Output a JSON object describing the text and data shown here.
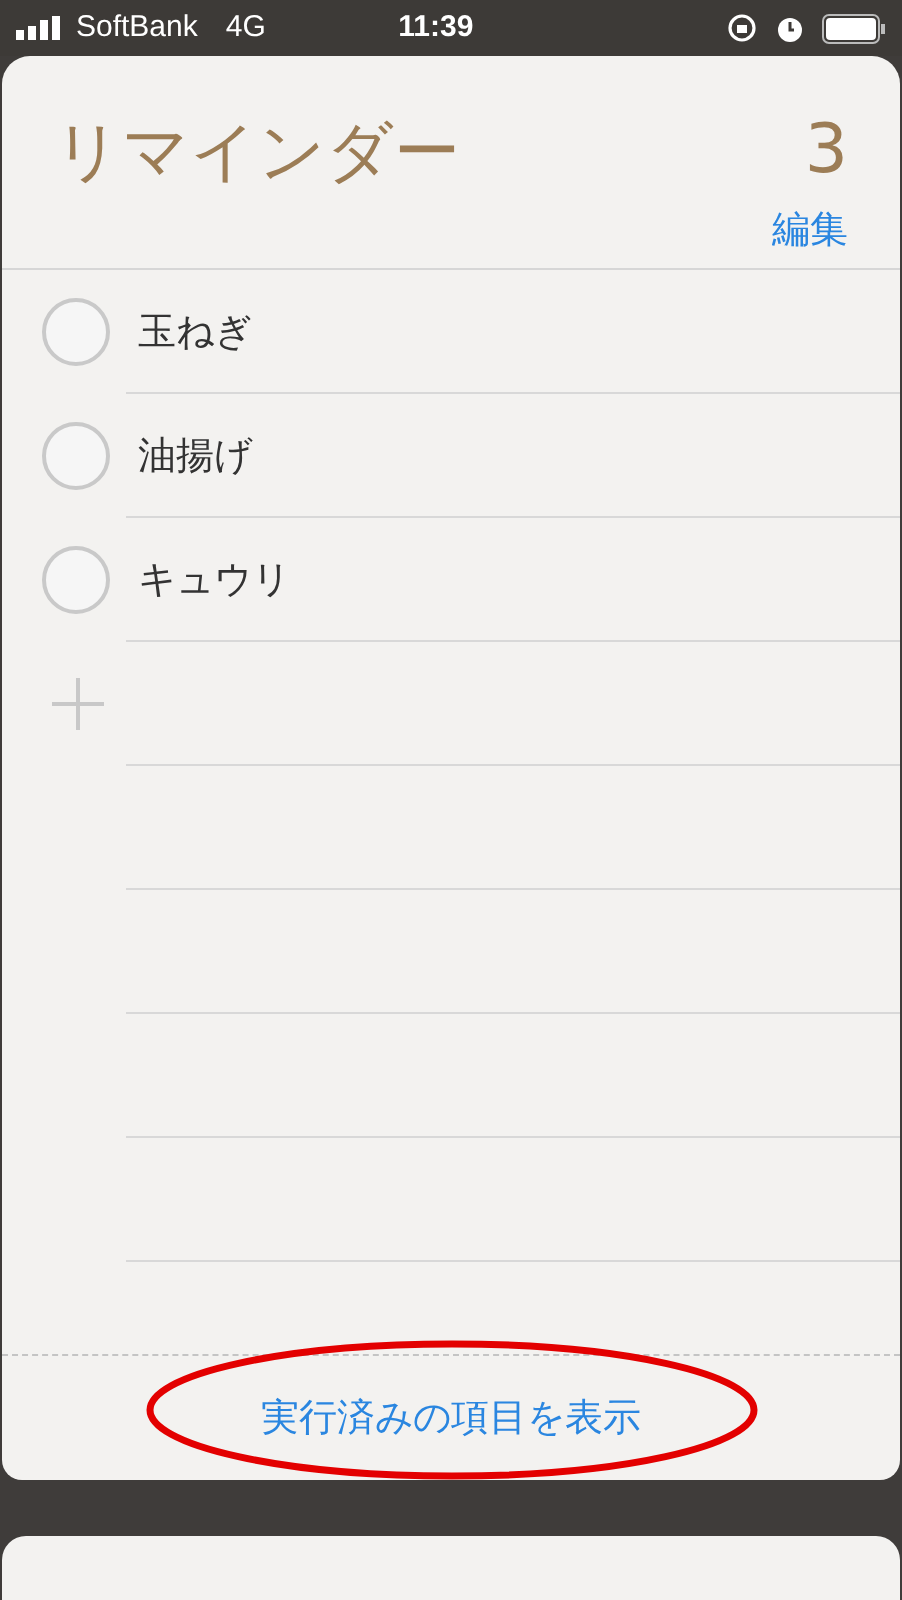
{
  "status_bar": {
    "carrier": "SoftBank",
    "network": "4G",
    "time": "11:39"
  },
  "list": {
    "title": "リマインダー",
    "count": "3",
    "edit": "編集"
  },
  "items": [
    {
      "text": "玉ねぎ",
      "checked": false
    },
    {
      "text": "油揚げ",
      "checked": false
    },
    {
      "text": "キュウリ",
      "checked": false
    }
  ],
  "show_completed": "実行済みの項目を表示"
}
